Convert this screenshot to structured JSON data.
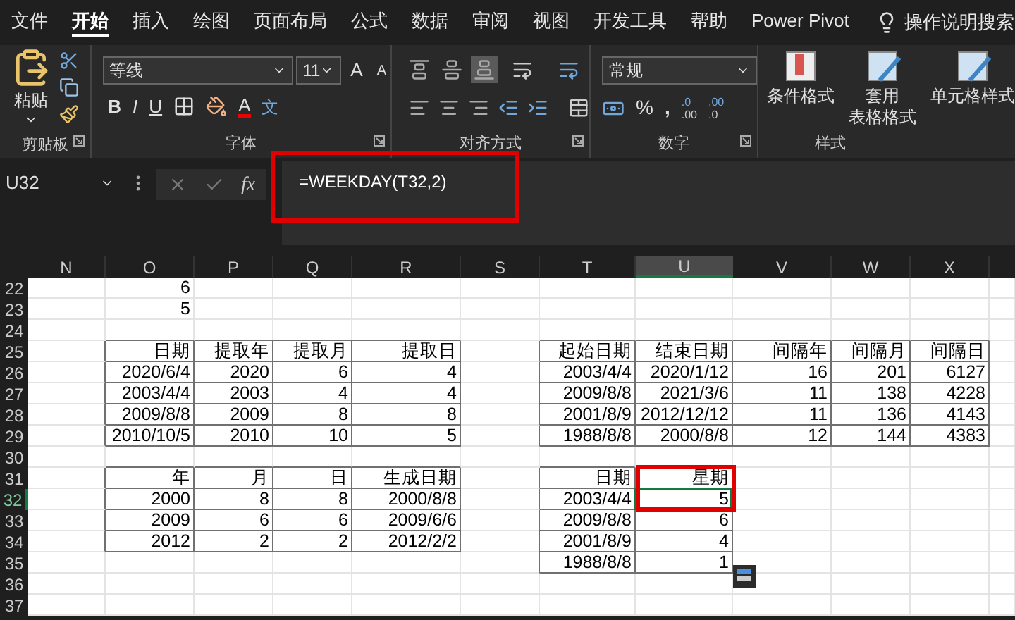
{
  "ribbon": {
    "tabs": [
      {
        "label": "文件",
        "selected": false
      },
      {
        "label": "开始",
        "selected": true
      },
      {
        "label": "插入",
        "selected": false
      },
      {
        "label": "绘图",
        "selected": false
      },
      {
        "label": "页面布局",
        "selected": false
      },
      {
        "label": "公式",
        "selected": false
      },
      {
        "label": "数据",
        "selected": false
      },
      {
        "label": "审阅",
        "selected": false
      },
      {
        "label": "视图",
        "selected": false
      },
      {
        "label": "开发工具",
        "selected": false
      },
      {
        "label": "帮助",
        "selected": false
      },
      {
        "label": "Power Pivot",
        "selected": false
      }
    ],
    "search": "操作说明搜索",
    "clipboard": {
      "paste": "粘贴",
      "label": "剪贴板"
    },
    "font": {
      "font_name": "等线",
      "font_size": "11",
      "grow": "A",
      "shrink": "A",
      "bold": "B",
      "italic": "I",
      "underline": "U",
      "font_color": "A",
      "phonetic": "文",
      "label": "字体"
    },
    "alignment": {
      "vertical": [
        {
          "selected": false
        },
        {
          "selected": false
        },
        {
          "selected": true
        }
      ],
      "label": "对齐方式"
    },
    "number": {
      "format": "常规",
      "percent": "%",
      "comma": ",",
      "decimals": [
        {
          "top": ".0",
          "bottom": ".00"
        },
        {
          "top": ".00",
          "bottom": ".0"
        }
      ],
      "label": "数字"
    },
    "styles": {
      "buttons": [
        {
          "kind": "conditional",
          "lines": [
            "条件格式"
          ]
        },
        {
          "kind": "table",
          "lines": [
            "套用",
            "表格格式"
          ]
        },
        {
          "kind": "cell",
          "lines": [
            "单元格样式"
          ]
        }
      ],
      "label": "样式"
    }
  },
  "formula_bar": {
    "name_box": "U32",
    "fx": "fx",
    "formula": "=WEEKDAY(T32,2)"
  },
  "sheet": {
    "columns": [
      {
        "label": "N",
        "selected": false
      },
      {
        "label": "O",
        "selected": false
      },
      {
        "label": "P",
        "selected": false
      },
      {
        "label": "Q",
        "selected": false
      },
      {
        "label": "R",
        "selected": false
      },
      {
        "label": "S",
        "selected": false
      },
      {
        "label": "T",
        "selected": false
      },
      {
        "label": "U",
        "selected": true
      },
      {
        "label": "V",
        "selected": false
      },
      {
        "label": "W",
        "selected": false
      },
      {
        "label": "X",
        "selected": false
      }
    ],
    "rows": [
      {
        "label": "22",
        "selected": false
      },
      {
        "label": "23",
        "selected": false
      },
      {
        "label": "24",
        "selected": false
      },
      {
        "label": "25",
        "selected": false
      },
      {
        "label": "26",
        "selected": false
      },
      {
        "label": "27",
        "selected": false
      },
      {
        "label": "28",
        "selected": false
      },
      {
        "label": "29",
        "selected": false
      },
      {
        "label": "30",
        "selected": false
      },
      {
        "label": "31",
        "selected": false
      },
      {
        "label": "32",
        "selected": true
      },
      {
        "label": "33",
        "selected": false
      },
      {
        "label": "34",
        "selected": false
      },
      {
        "label": "35",
        "selected": false
      },
      {
        "label": "36",
        "selected": false
      },
      {
        "label": "37",
        "selected": false
      }
    ],
    "loose_values": [
      "6",
      "5"
    ],
    "date_parts": {
      "header": [
        "日期",
        "提取年",
        "提取月",
        "提取日"
      ],
      "rows": [
        [
          "2020/6/4",
          "2020",
          "6",
          "4"
        ],
        [
          "2003/4/4",
          "2003",
          "4",
          "4"
        ],
        [
          "2009/8/8",
          "2009",
          "8",
          "8"
        ],
        [
          "2010/10/5",
          "2010",
          "10",
          "5"
        ]
      ]
    },
    "build_date": {
      "header": [
        "年",
        "月",
        "日",
        "生成日期"
      ],
      "rows": [
        [
          "2000",
          "8",
          "8",
          "2000/8/8"
        ],
        [
          "2009",
          "6",
          "6",
          "2009/6/6"
        ],
        [
          "2012",
          "2",
          "2",
          "2012/2/2"
        ]
      ]
    },
    "intervals": {
      "header": [
        "起始日期",
        "结束日期",
        "间隔年",
        "间隔月",
        "间隔日"
      ],
      "rows": [
        [
          "2003/4/4",
          "2020/1/12",
          "16",
          "201",
          "6127"
        ],
        [
          "2009/8/8",
          "2021/3/6",
          "11",
          "138",
          "4228"
        ],
        [
          "2001/8/9",
          "2012/12/12",
          "11",
          "136",
          "4143"
        ],
        [
          "1988/8/8",
          "2000/8/8",
          "12",
          "144",
          "4383"
        ]
      ]
    },
    "weekday": {
      "header": [
        "日期",
        "星期"
      ],
      "rows": [
        [
          "2003/4/4",
          "5"
        ],
        [
          "2009/8/8",
          "6"
        ],
        [
          "2001/8/9",
          "4"
        ],
        [
          "1988/8/8",
          "1"
        ]
      ]
    }
  }
}
